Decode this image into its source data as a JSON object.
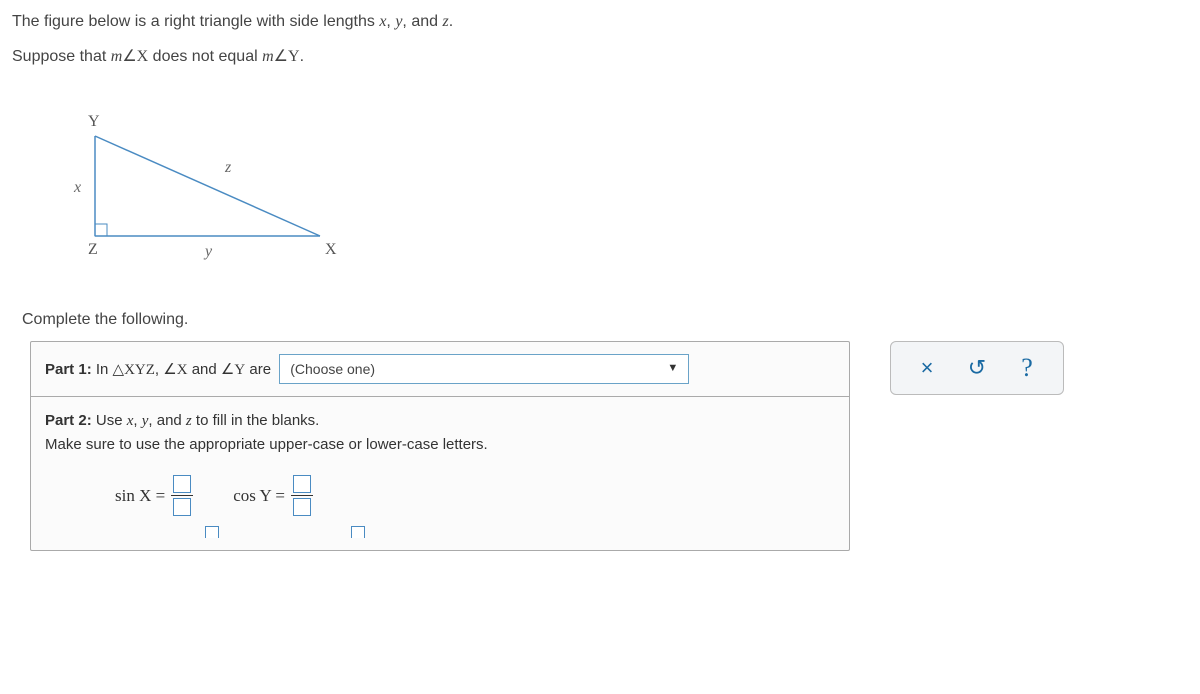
{
  "intro": {
    "line1_prefix": "The figure below is a right triangle with side lengths ",
    "var_x": "x",
    "comma1": ", ",
    "var_y": "y",
    "comma_and": ", and ",
    "var_z": "z",
    "period": ".",
    "line2_prefix": "Suppose that ",
    "m1": "m",
    "angle_X": "∠X",
    "not_equal": " does not equal ",
    "m2": "m",
    "angle_Y": "∠Y",
    "period2": "."
  },
  "triangle": {
    "Y": "Y",
    "X": "X",
    "Z": "Z",
    "side_x": "x",
    "side_y": "y",
    "side_z": "z"
  },
  "complete_text": "Complete the following.",
  "part1": {
    "label": "Part 1:",
    "text_in": " In ",
    "tri_name": "△XYZ",
    "comma": ", ",
    "ang_X": "∠X",
    "and": " and ",
    "ang_Y": "∠Y",
    "are": " are ",
    "choose": "(Choose one)"
  },
  "part2": {
    "label": "Part 2:",
    "line1_a": " Use ",
    "v_x": "x",
    "c1": ", ",
    "v_y": "y",
    "c_and": ", and ",
    "v_z": "z",
    "line1_b": " to fill in the blanks.",
    "line2": "Make sure to use the appropriate upper-case or lower-case letters.",
    "sinX": "sin X =",
    "cosY": "cos Y ="
  },
  "toolbar": {
    "close": "×",
    "reset": "↺",
    "help": "?"
  }
}
